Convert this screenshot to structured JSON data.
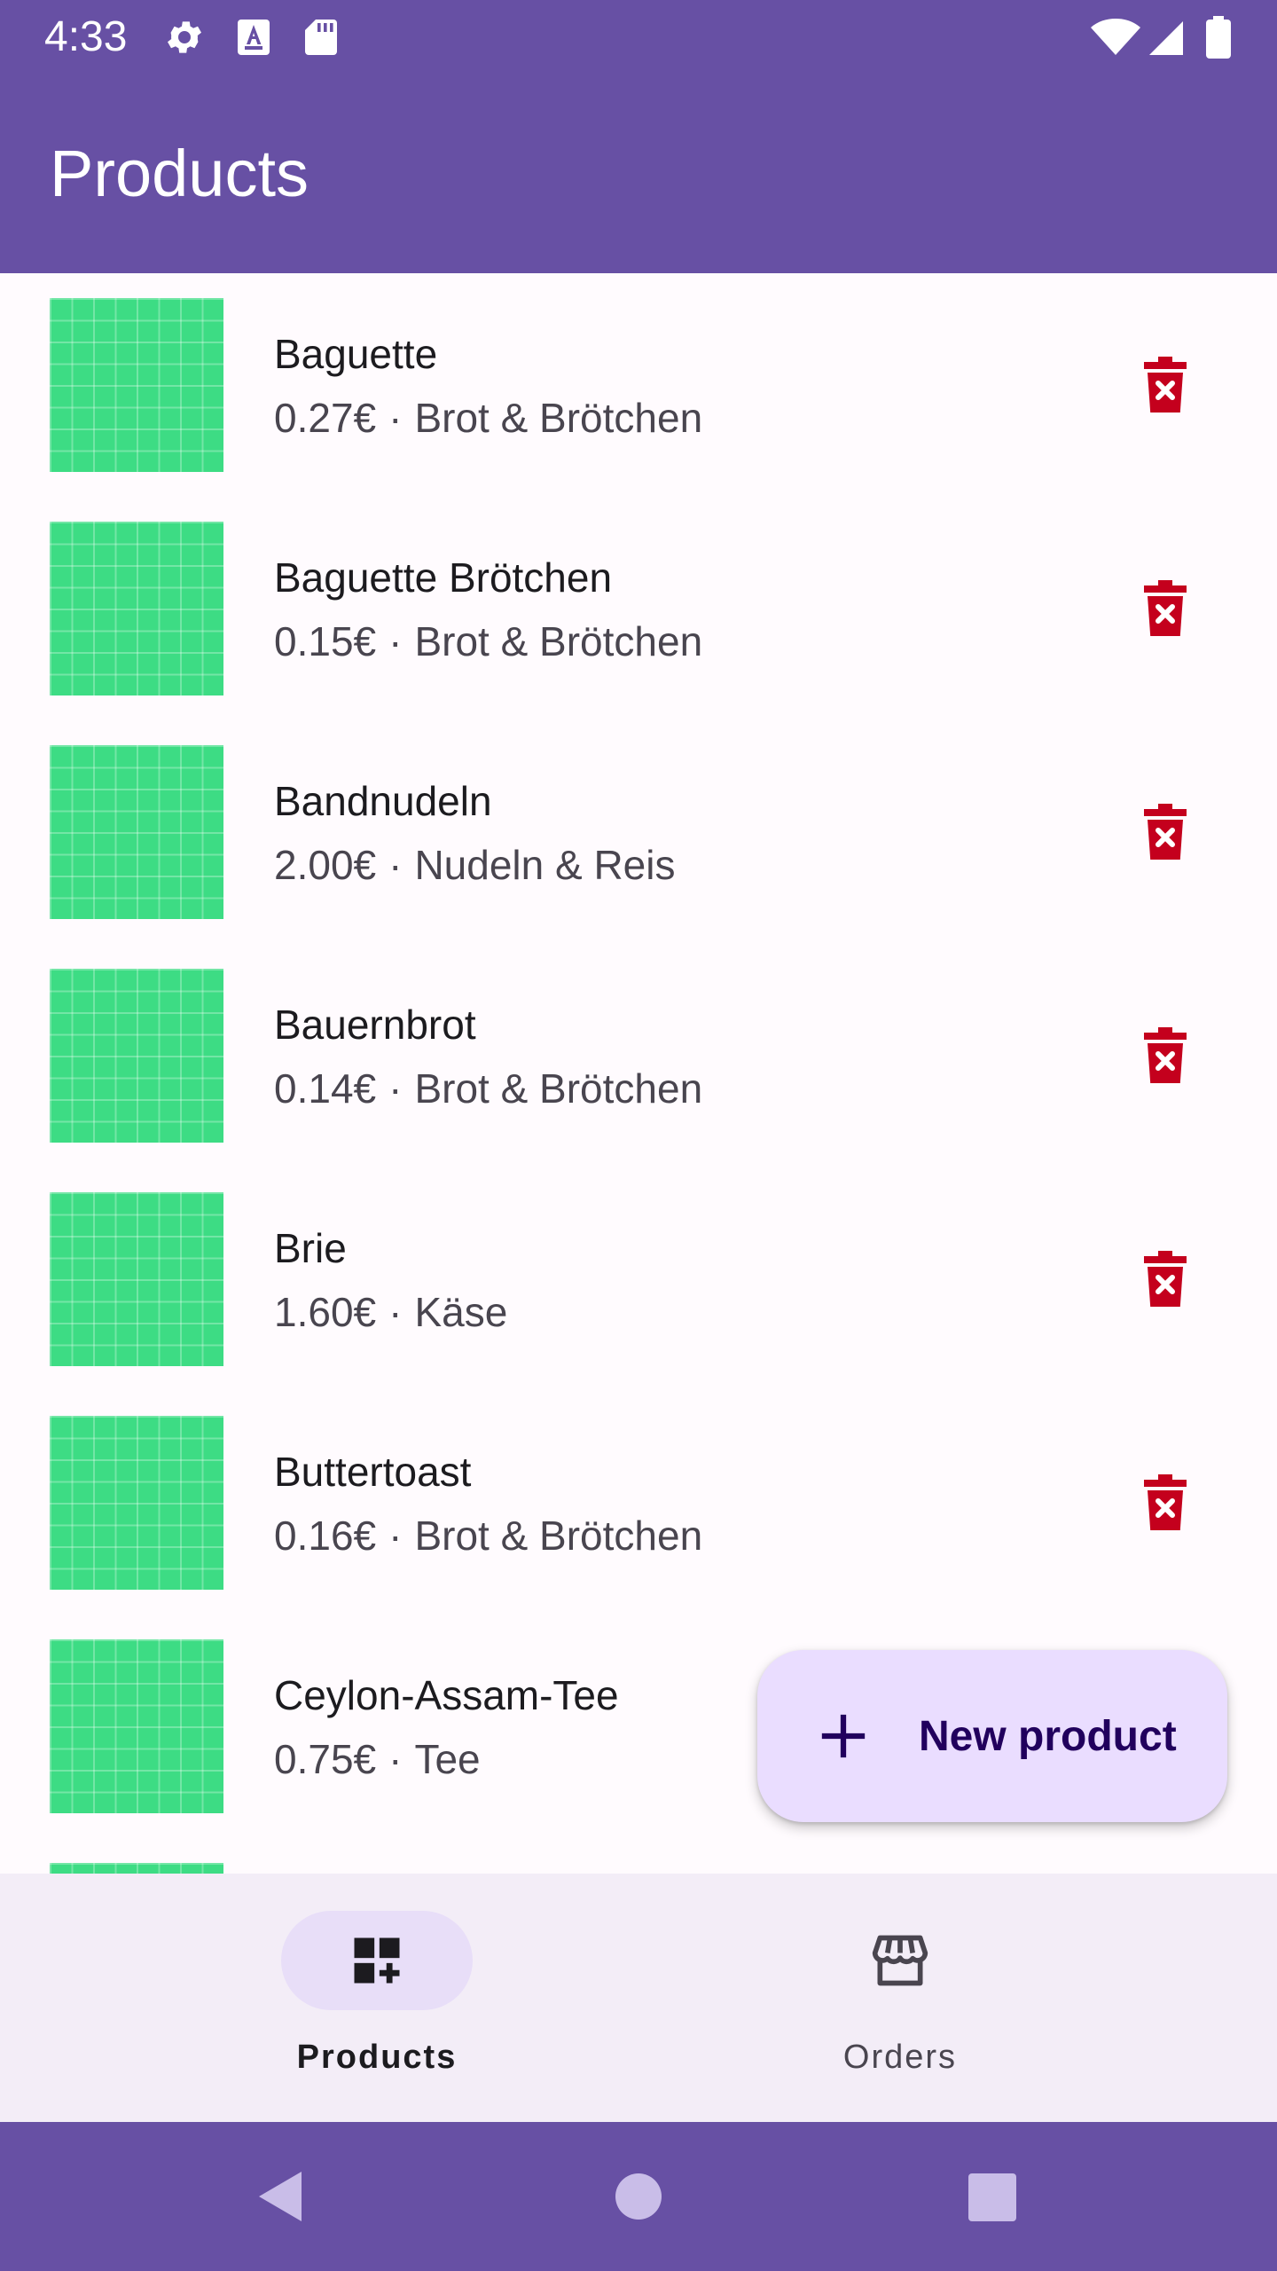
{
  "status_bar": {
    "time": "4:33",
    "icons": [
      "gear-icon",
      "text-a-icon",
      "sd-card-icon",
      "wifi-icon",
      "signal-icon",
      "battery-icon"
    ]
  },
  "app_bar": {
    "title": "Products"
  },
  "products": [
    {
      "name": "Baguette",
      "price": "0.27€",
      "category": "Brot & Brötchen"
    },
    {
      "name": "Baguette Brötchen",
      "price": "0.15€",
      "category": "Brot & Brötchen"
    },
    {
      "name": "Bandnudeln",
      "price": "2.00€",
      "category": "Nudeln & Reis"
    },
    {
      "name": "Bauernbrot",
      "price": "0.14€",
      "category": "Brot & Brötchen"
    },
    {
      "name": "Brie",
      "price": "1.60€",
      "category": "Käse"
    },
    {
      "name": "Buttertoast",
      "price": "0.16€",
      "category": "Brot & Brötchen"
    },
    {
      "name": "Ceylon-Assam-Tee",
      "price": "0.75€",
      "category": "Tee"
    }
  ],
  "separator": "·",
  "fab": {
    "label": "New product",
    "icon": "plus-icon"
  },
  "bottom_nav": {
    "items": [
      {
        "label": "Products",
        "icon": "dashboard-add-icon",
        "active": true
      },
      {
        "label": "Orders",
        "icon": "storefront-icon",
        "active": false
      }
    ]
  },
  "system_nav": [
    "back-icon",
    "home-icon",
    "recents-icon"
  ],
  "colors": {
    "primary": "#6750a4",
    "thumbnail": "#3ddc84",
    "delete": "#c4001d",
    "fab_container": "#eaddff",
    "nav_background": "#f3edf7",
    "nav_indicator": "#e8def8"
  }
}
